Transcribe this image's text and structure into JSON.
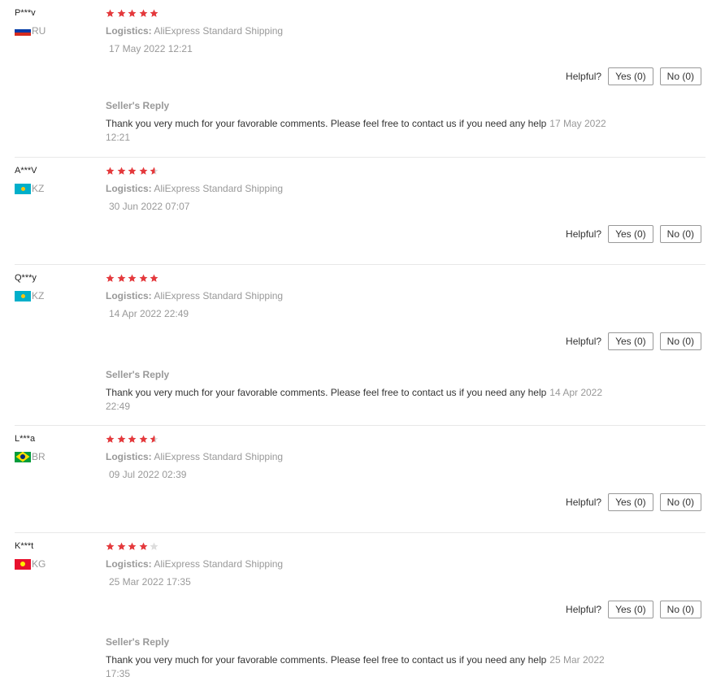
{
  "colors": {
    "star_on": "#e4393c",
    "star_off": "#dddddd"
  },
  "labels": {
    "logistics": "Logistics:",
    "helpful": "Helpful?",
    "seller_reply": "Seller's Reply"
  },
  "reviews": [
    {
      "user": "P***v",
      "country": "RU",
      "flag": "ru-flag-icon",
      "rating": 5,
      "logistics": "AliExpress Standard Shipping",
      "date": "17 May 2022 12:21",
      "yes": "Yes (0)",
      "no": "No (0)",
      "reply": {
        "text": "Thank you very much for your favorable comments. Please feel free to contact us if you need any help",
        "date": "17 May 2022 12:21"
      }
    },
    {
      "user": "A***V",
      "country": "KZ",
      "flag": "kz-flag-icon",
      "rating": 4.5,
      "logistics": "AliExpress Standard Shipping",
      "date": "30 Jun 2022 07:07",
      "yes": "Yes (0)",
      "no": "No (0)",
      "reply": null
    },
    {
      "user": "Q***y",
      "country": "KZ",
      "flag": "kz-flag-icon",
      "rating": 5,
      "logistics": "AliExpress Standard Shipping",
      "date": "14 Apr 2022 22:49",
      "yes": "Yes (0)",
      "no": "No (0)",
      "reply": {
        "text": "Thank you very much for your favorable comments. Please feel free to contact us if you need any help",
        "date": "14 Apr 2022 22:49"
      }
    },
    {
      "user": "L***a",
      "country": "BR",
      "flag": "br-flag-icon",
      "rating": 4.5,
      "logistics": "AliExpress Standard Shipping",
      "date": "09 Jul 2022 02:39",
      "yes": "Yes (0)",
      "no": "No (0)",
      "reply": null
    },
    {
      "user": "K***t",
      "country": "KG",
      "flag": "kg-flag-icon",
      "rating": 4,
      "logistics": "AliExpress Standard Shipping",
      "date": "25 Mar 2022 17:35",
      "yes": "Yes (0)",
      "no": "No (0)",
      "reply": {
        "text": "Thank you very much for your favorable comments. Please feel free to contact us if you need any help",
        "date": "25 Mar 2022 17:35"
      }
    }
  ]
}
